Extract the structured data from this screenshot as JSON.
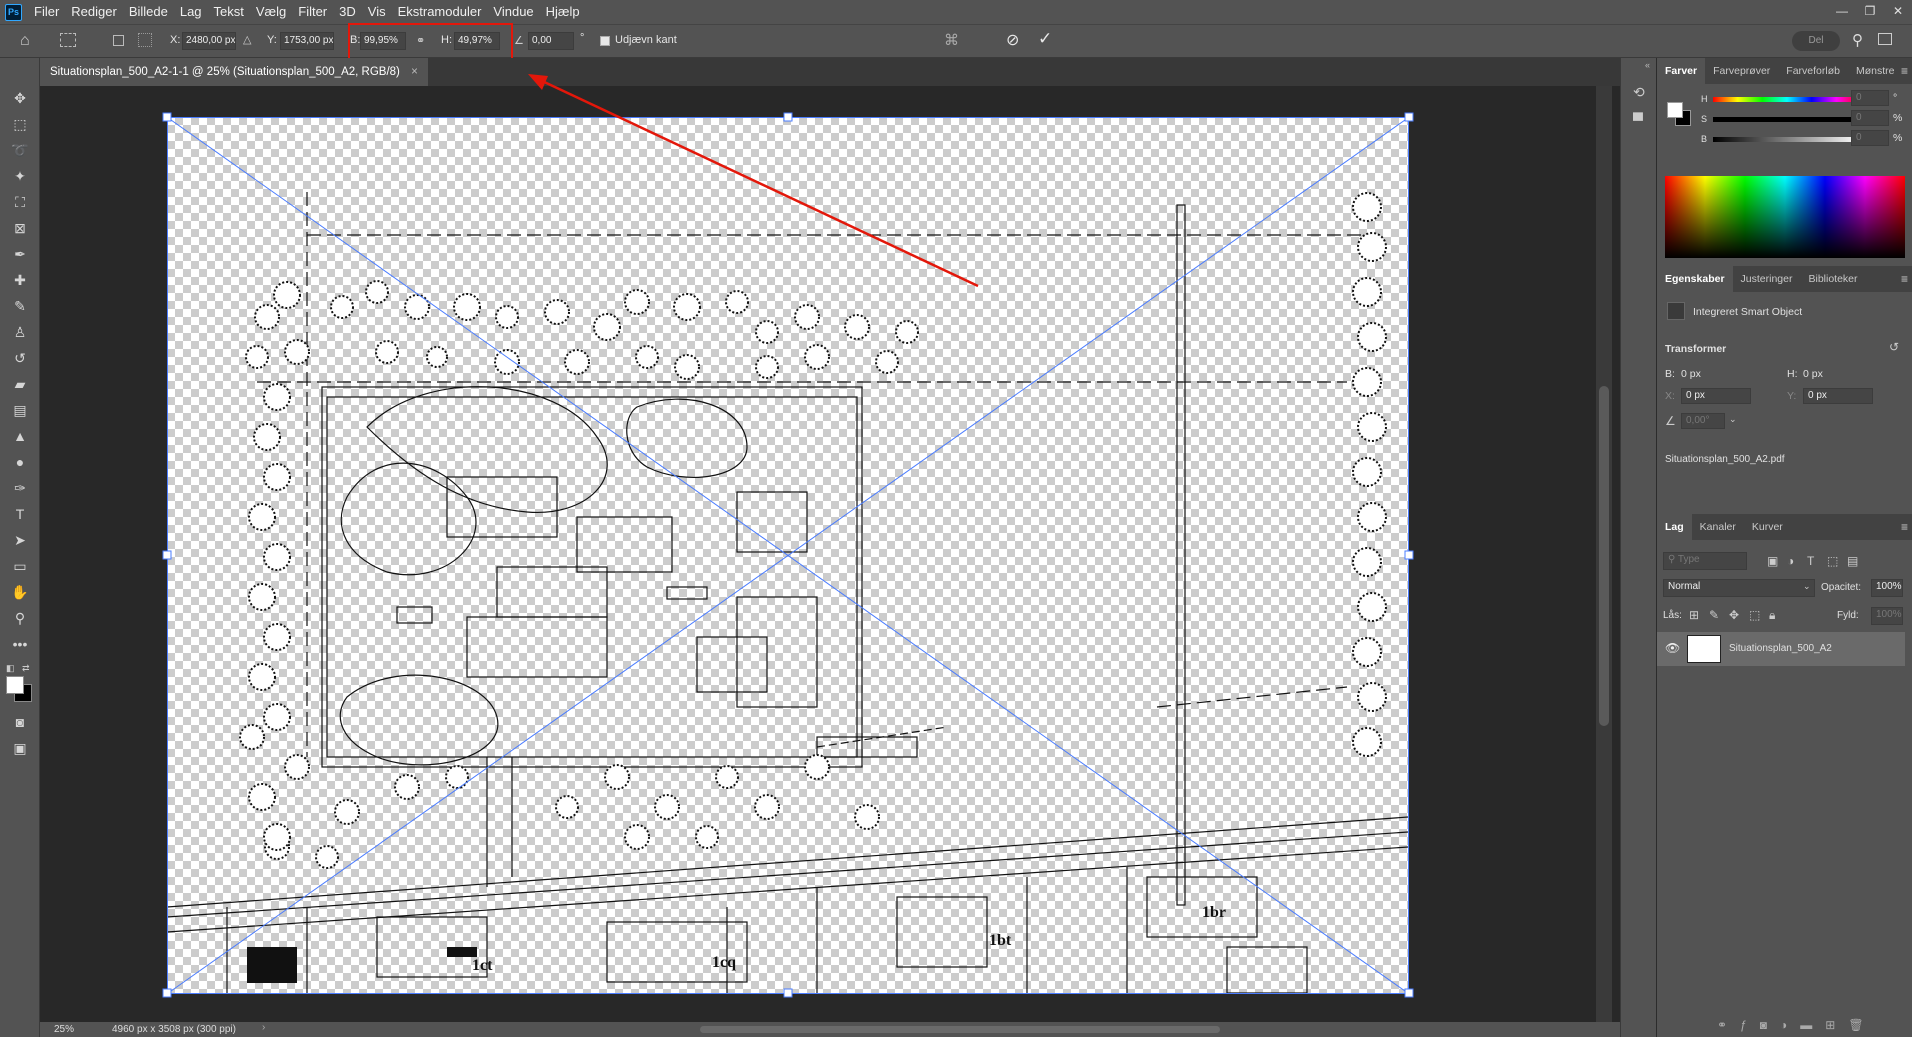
{
  "menubar": {
    "logo": "Ps",
    "items": [
      "Filer",
      "Rediger",
      "Billede",
      "Lag",
      "Tekst",
      "Vælg",
      "Filter",
      "3D",
      "Vis",
      "Ekstramoduler",
      "Vindue",
      "Hjælp"
    ]
  },
  "options": {
    "x_label": "X:",
    "x_value": "2480,00 px",
    "y_label": "Y:",
    "y_value": "1753,00 px",
    "w_label": "B:",
    "w_value": "99,95%",
    "h_label": "H:",
    "h_value": "49,97%",
    "angle_value": "0,00",
    "angle_unit": "°",
    "antialias_label": "Udjævn kant",
    "share_label": "Del"
  },
  "document": {
    "tab_title": "Situationsplan_500_A2-1-1 @ 25% (Situationsplan_500_A2, RGB/8)"
  },
  "status": {
    "zoom": "25%",
    "dimensions": "4960 px x 3508 px (300 ppi)"
  },
  "plan_labels": [
    "1ct",
    "1cq",
    "1bt",
    "1br"
  ],
  "annotation": {
    "highlight_color": "#e3170a"
  },
  "panels": {
    "color": {
      "tabs": [
        "Farver",
        "Farveprøver",
        "Farveforløb",
        "Mønstre"
      ],
      "h_label": "H",
      "s_label": "S",
      "b_label": "B",
      "h_value": "0",
      "s_value": "0",
      "b_value": "0",
      "deg_unit": "°",
      "pct_unit": "%"
    },
    "properties": {
      "tabs": [
        "Egenskaber",
        "Justeringer",
        "Biblioteker"
      ],
      "type_label": "Integreret Smart Object",
      "section_title": "Transformer",
      "w_label": "B:",
      "w_value": "0 px",
      "h_label": "H:",
      "h_value": "0 px",
      "x_label": "X:",
      "x_value": "0 px",
      "y_label": "Y:",
      "y_value": "0 px",
      "angle_value": "0,00°",
      "filename": "Situationsplan_500_A2.pdf"
    },
    "layers": {
      "tabs": [
        "Lag",
        "Kanaler",
        "Kurver"
      ],
      "search_placeholder": "Type",
      "blend_mode": "Normal",
      "opacity_label": "Opacitet:",
      "opacity_value": "100%",
      "lock_label": "Lås:",
      "fill_label": "Fyld:",
      "fill_value": "100%",
      "layer_name": "Situationsplan_500_A2"
    }
  }
}
